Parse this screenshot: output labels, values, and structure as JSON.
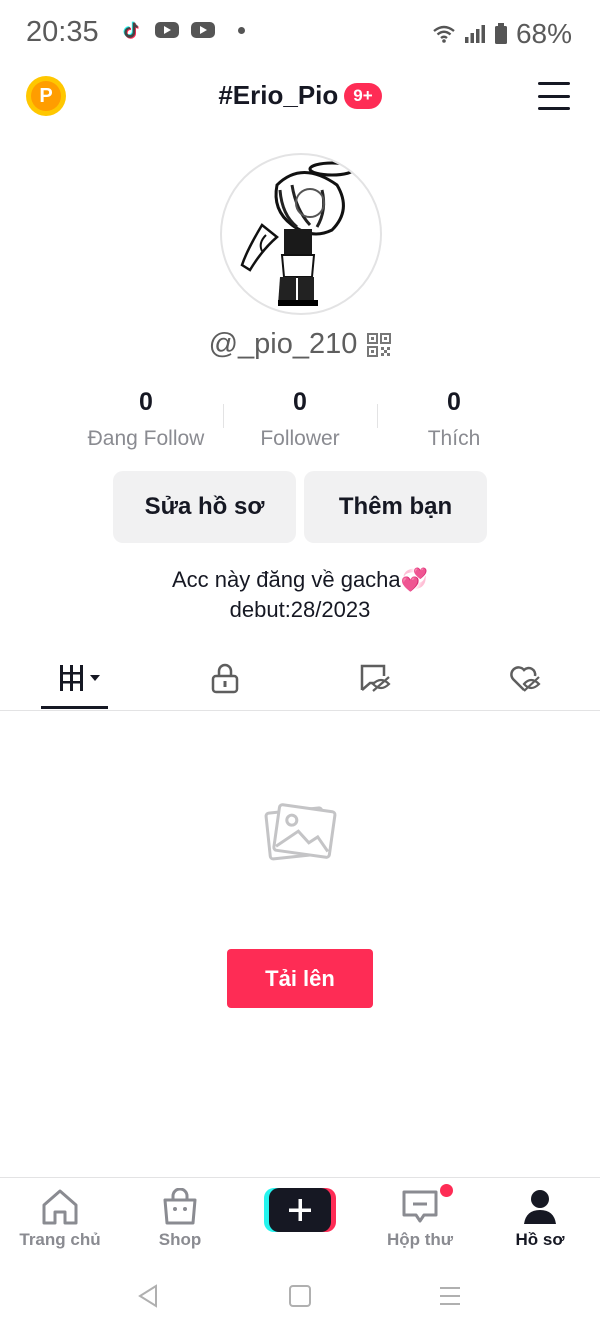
{
  "status_bar": {
    "time": "20:35",
    "battery": "68%",
    "icons": [
      "tiktok-icon",
      "youtube-icon",
      "youtube-icon",
      "dot-icon",
      "wifi-icon",
      "signal-icon",
      "battery-icon"
    ]
  },
  "header": {
    "title": "#Erio_Pio",
    "badge": "9+",
    "coin_label": "P"
  },
  "profile": {
    "username": "@_pio_210",
    "stats": [
      {
        "value": "0",
        "label": "Đang Follow"
      },
      {
        "value": "0",
        "label": "Follower"
      },
      {
        "value": "0",
        "label": "Thích"
      }
    ],
    "buttons": {
      "edit": "Sửa hồ sơ",
      "add_friend": "Thêm bạn"
    },
    "bio_line1": "Acc này đăng về gacha💞",
    "bio_line2": "debut:28/2023"
  },
  "tabs": [
    {
      "icon": "grid-icon",
      "active": true
    },
    {
      "icon": "lock-icon",
      "active": false
    },
    {
      "icon": "hidden-tag-icon",
      "active": false
    },
    {
      "icon": "hidden-heart-icon",
      "active": false
    }
  ],
  "empty_state": {
    "upload_label": "Tải lên"
  },
  "bottom_nav": {
    "items": [
      {
        "label": "Trang chủ",
        "icon": "home-icon"
      },
      {
        "label": "Shop",
        "icon": "shop-icon"
      },
      {
        "label": "",
        "icon": "plus-icon"
      },
      {
        "label": "Hộp thư",
        "icon": "inbox-icon"
      },
      {
        "label": "Hồ sơ",
        "icon": "profile-icon"
      }
    ]
  },
  "colors": {
    "accent": "#fe2c55",
    "text": "#161823",
    "muted": "#8a8b91",
    "coin": "#ffc700"
  }
}
